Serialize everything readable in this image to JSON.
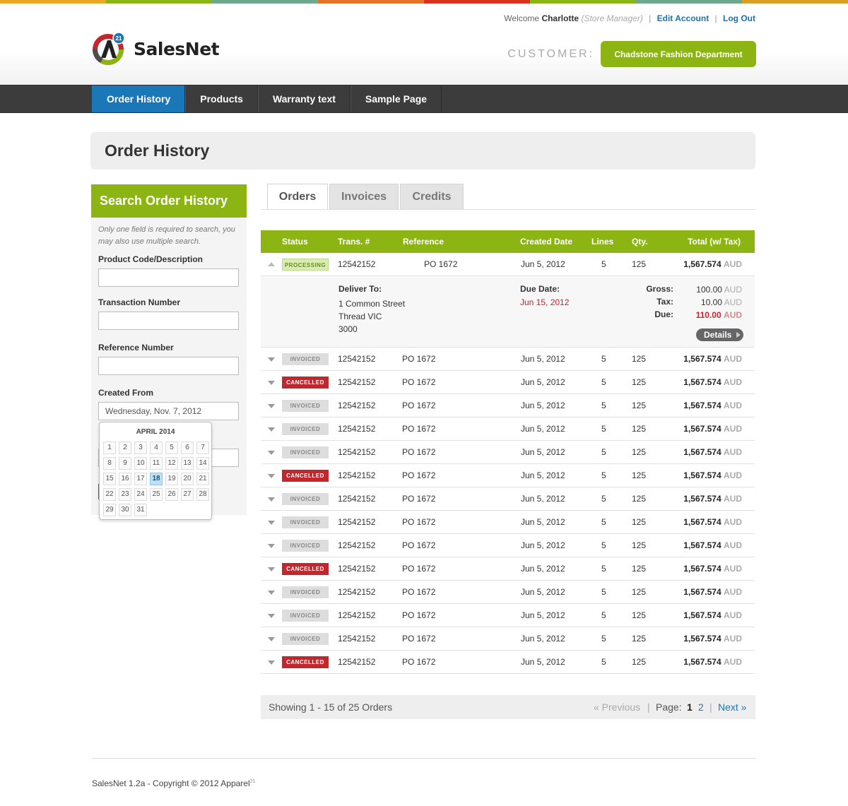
{
  "header": {
    "brand": "SalesNet",
    "welcome": "Welcome",
    "user": "Charlotte",
    "role": "(Store Manager)",
    "edit_account": "Edit Account",
    "log_out": "Log Out",
    "customer_label": "CUSTOMER:",
    "customer_name": "Chadstone Fashion Department",
    "stripe_colors": [
      "#e8a823",
      "#8cb514",
      "#6da98f",
      "#e3742a",
      "#d8331f",
      "#8cb514",
      "#6da98f",
      "#d8a126"
    ]
  },
  "nav": {
    "items": [
      "Order History",
      "Products",
      "Warranty text",
      "Sample Page"
    ],
    "active": "Order History"
  },
  "page_title": "Order History",
  "search": {
    "title": "Search Order History",
    "note": "Only one field is required to search, you may also use multiple search.",
    "product_label": "Product Code/Description",
    "transaction_label": "Transaction Number",
    "reference_label": "Reference Number",
    "created_from_label": "Created From",
    "created_from_value": "Wednesday, Nov. 7, 2012"
  },
  "calendar": {
    "title": "APRIL 2014",
    "selected": "18",
    "days": [
      "1",
      "2",
      "3",
      "4",
      "5",
      "6",
      "7",
      "8",
      "9",
      "10",
      "11",
      "12",
      "13",
      "14",
      "15",
      "16",
      "17",
      "18",
      "19",
      "20",
      "21",
      "22",
      "23",
      "24",
      "25",
      "26",
      "27",
      "28",
      "29",
      "30",
      "31"
    ]
  },
  "tabs": [
    "Orders",
    "Invoices",
    "Credits"
  ],
  "table": {
    "headers": {
      "status": "Status",
      "trans": "Trans. #",
      "reference": "Reference",
      "created": "Created Date",
      "lines": "Lines",
      "qty": "Qty.",
      "total": "Total (w/ Tax)"
    },
    "currency": "AUD",
    "rows": [
      {
        "status": "PROCESSING",
        "trans": "12542152",
        "reference": "PO 1672",
        "created": "Jun 5, 2012",
        "lines": "5",
        "qty": "125",
        "total": "1,567.574"
      },
      {
        "status": "INVOICED",
        "trans": "12542152",
        "reference": "PO 1672",
        "created": "Jun 5, 2012",
        "lines": "5",
        "qty": "125",
        "total": "1,567.574"
      },
      {
        "status": "CANCELLED",
        "trans": "12542152",
        "reference": "PO 1672",
        "created": "Jun 5, 2012",
        "lines": "5",
        "qty": "125",
        "total": "1,567.574"
      },
      {
        "status": "INVOICED",
        "trans": "12542152",
        "reference": "PO 1672",
        "created": "Jun 5, 2012",
        "lines": "5",
        "qty": "125",
        "total": "1,567.574"
      },
      {
        "status": "INVOICED",
        "trans": "12542152",
        "reference": "PO 1672",
        "created": "Jun 5, 2012",
        "lines": "5",
        "qty": "125",
        "total": "1,567.574"
      },
      {
        "status": "INVOICED",
        "trans": "12542152",
        "reference": "PO 1672",
        "created": "Jun 5, 2012",
        "lines": "5",
        "qty": "125",
        "total": "1,567.574"
      },
      {
        "status": "CANCELLED",
        "trans": "12542152",
        "reference": "PO 1672",
        "created": "Jun 5, 2012",
        "lines": "5",
        "qty": "125",
        "total": "1,567.574"
      },
      {
        "status": "INVOICED",
        "trans": "12542152",
        "reference": "PO 1672",
        "created": "Jun 5, 2012",
        "lines": "5",
        "qty": "125",
        "total": "1,567.574"
      },
      {
        "status": "INVOICED",
        "trans": "12542152",
        "reference": "PO 1672",
        "created": "Jun 5, 2012",
        "lines": "5",
        "qty": "125",
        "total": "1,567.574"
      },
      {
        "status": "INVOICED",
        "trans": "12542152",
        "reference": "PO 1672",
        "created": "Jun 5, 2012",
        "lines": "5",
        "qty": "125",
        "total": "1,567.574"
      },
      {
        "status": "CANCELLED",
        "trans": "12542152",
        "reference": "PO 1672",
        "created": "Jun 5, 2012",
        "lines": "5",
        "qty": "125",
        "total": "1,567.574"
      },
      {
        "status": "INVOICED",
        "trans": "12542152",
        "reference": "PO 1672",
        "created": "Jun 5, 2012",
        "lines": "5",
        "qty": "125",
        "total": "1,567.574"
      },
      {
        "status": "INVOICED",
        "trans": "12542152",
        "reference": "PO 1672",
        "created": "Jun 5, 2012",
        "lines": "5",
        "qty": "125",
        "total": "1,567.574"
      },
      {
        "status": "INVOICED",
        "trans": "12542152",
        "reference": "PO 1672",
        "created": "Jun 5, 2012",
        "lines": "5",
        "qty": "125",
        "total": "1,567.574"
      },
      {
        "status": "CANCELLED",
        "trans": "12542152",
        "reference": "PO 1672",
        "created": "Jun 5, 2012",
        "lines": "5",
        "qty": "125",
        "total": "1,567.574"
      }
    ]
  },
  "detail": {
    "deliver_label": "Deliver To:",
    "address1": "1 Common Street",
    "address2": "Thread VIC",
    "address3": "3000",
    "due_label": "Due Date:",
    "due_date": "Jun 15, 2012",
    "gross_label": "Gross:",
    "gross": "100.00",
    "tax_label": "Tax:",
    "tax": "10.00",
    "due_amount_label": "Due:",
    "due_amount": "110.00",
    "details_button": "Details"
  },
  "pager": {
    "showing": "Showing 1 - 15 of 25 Orders",
    "previous": "« Previous",
    "page_label": "Page:",
    "pages": [
      "1",
      "2"
    ],
    "current": "1",
    "next": "Next »"
  },
  "footer": {
    "text": "SalesNet 1.2a - Copyright © 2012 Apparel",
    "sup": "21"
  }
}
